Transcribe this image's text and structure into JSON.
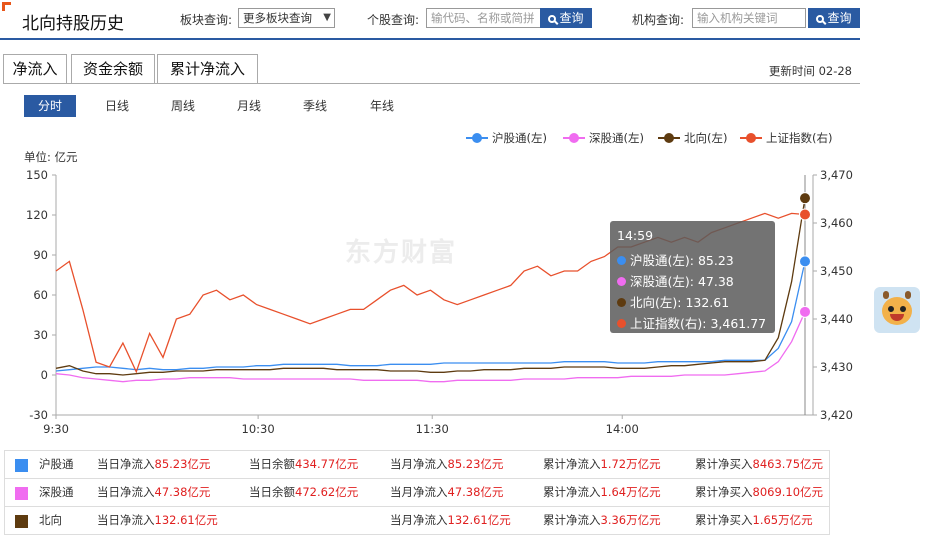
{
  "header": {
    "title": "北向持股历史",
    "sector_label": "板块查询:",
    "sector_select": "更多板块查询",
    "stock_label": "个股查询:",
    "stock_placeholder": "输代码、名称或简拼",
    "search_label": "查询",
    "inst_label": "机构查询:",
    "inst_placeholder": "输入机构关键词"
  },
  "tabs": [
    "净流入",
    "资金余额",
    "累计净流入"
  ],
  "update_time": "更新时间 02-28",
  "periods": [
    "分时",
    "日线",
    "周线",
    "月线",
    "季线",
    "年线"
  ],
  "unit_label": "单位: 亿元",
  "watermark": "东方财富",
  "tooltip": {
    "time": "14:59",
    "rows": [
      {
        "text": "沪股通(左): 85.23",
        "color": "#3b8ef0"
      },
      {
        "text": "深股通(左): 47.38",
        "color": "#f06cf0"
      },
      {
        "text": "北向(左): 132.61",
        "color": "#5e3b10"
      },
      {
        "text": "上证指数(右): 3,461.77",
        "color": "#e8502c"
      }
    ]
  },
  "chart_data": {
    "type": "line",
    "x_ticks": [
      "9:30",
      "10:30",
      "11:30",
      "14:00"
    ],
    "y_left": {
      "min": -30,
      "max": 150,
      "ticks": [
        -30,
        0,
        30,
        60,
        90,
        120,
        150
      ]
    },
    "y_right": {
      "min": 3420,
      "max": 3470,
      "ticks": [
        "3,420",
        "3,430",
        "3,440",
        "3,450",
        "3,460",
        "3,470"
      ]
    },
    "legend_position": "top-right",
    "grid": false,
    "series": [
      {
        "name": "沪股通(左)",
        "color": "#3b8ef0",
        "axis": "left",
        "values": [
          3,
          4,
          5,
          6,
          6,
          5,
          4,
          5,
          4,
          4,
          5,
          5,
          6,
          6,
          6,
          7,
          7,
          8,
          8,
          8,
          8,
          8,
          7,
          7,
          7,
          8,
          8,
          8,
          8,
          9,
          9,
          9,
          9,
          9,
          9,
          9,
          9,
          9,
          10,
          10,
          10,
          10,
          9,
          9,
          9,
          10,
          10,
          10,
          10,
          10,
          11,
          11,
          11,
          11,
          20,
          40,
          85.23
        ]
      },
      {
        "name": "深股通(左)",
        "color": "#f06cf0",
        "axis": "left",
        "values": [
          1,
          0,
          -2,
          -3,
          -4,
          -5,
          -4,
          -4,
          -3,
          -3,
          -2,
          -2,
          -2,
          -2,
          -3,
          -3,
          -3,
          -3,
          -3,
          -3,
          -3,
          -3,
          -3,
          -4,
          -4,
          -4,
          -4,
          -4,
          -5,
          -5,
          -4,
          -4,
          -4,
          -4,
          -4,
          -3,
          -3,
          -3,
          -3,
          -2,
          -2,
          -2,
          -2,
          -1,
          -1,
          -1,
          -1,
          0,
          0,
          0,
          0,
          1,
          2,
          3,
          10,
          25,
          47.38
        ]
      },
      {
        "name": "北向(左)",
        "color": "#5e3b10",
        "axis": "left",
        "values": [
          5,
          7,
          3,
          1,
          1,
          0,
          1,
          2,
          2,
          3,
          3,
          3,
          4,
          4,
          4,
          4,
          4,
          5,
          5,
          5,
          5,
          4,
          4,
          4,
          4,
          3,
          3,
          3,
          2,
          2,
          3,
          3,
          4,
          4,
          4,
          5,
          5,
          5,
          6,
          6,
          6,
          6,
          5,
          5,
          5,
          6,
          7,
          7,
          8,
          9,
          10,
          10,
          10,
          11,
          28,
          70,
          132.61
        ]
      },
      {
        "name": "上证指数(右)",
        "color": "#e8502c",
        "axis": "right",
        "values": [
          3450,
          3452,
          3442,
          3431,
          3430,
          3435,
          3429,
          3437,
          3432,
          3440,
          3441,
          3445,
          3446,
          3444,
          3445,
          3443,
          3442,
          3441,
          3440,
          3439,
          3440,
          3441,
          3442,
          3442,
          3444,
          3446,
          3447,
          3445,
          3446,
          3444,
          3443,
          3444,
          3445,
          3446,
          3447,
          3450,
          3451,
          3449,
          3450,
          3450,
          3452,
          3453,
          3455,
          3455,
          3456,
          3457,
          3456,
          3457,
          3456,
          3458,
          3459,
          3460,
          3461,
          3462,
          3461,
          3462,
          3461.77
        ]
      }
    ]
  },
  "stats": [
    {
      "name": "沪股通",
      "color": "#3b8ef0",
      "day_label": "当日净流入",
      "day_val": "85.23亿元",
      "bal_label": "当日余额",
      "bal_val": "434.77亿元",
      "month_label": "当月净流入",
      "month_val": "85.23亿元",
      "cum_label": "累计净流入",
      "cum_val": "1.72万亿元",
      "buy_label": "累计净买入",
      "buy_val": "8463.75亿元"
    },
    {
      "name": "深股通",
      "color": "#f06cf0",
      "day_label": "当日净流入",
      "day_val": "47.38亿元",
      "bal_label": "当日余额",
      "bal_val": "472.62亿元",
      "month_label": "当月净流入",
      "month_val": "47.38亿元",
      "cum_label": "累计净流入",
      "cum_val": "1.64万亿元",
      "buy_label": "累计净买入",
      "buy_val": "8069.10亿元"
    },
    {
      "name": "北向",
      "color": "#5e3b10",
      "day_label": "当日净流入",
      "day_val": "132.61亿元",
      "bal_label": "",
      "bal_val": "",
      "month_label": "当月净流入",
      "month_val": "132.61亿元",
      "cum_label": "累计净流入",
      "cum_val": "3.36万亿元",
      "buy_label": "累计净买入",
      "buy_val": "1.65万亿元"
    }
  ]
}
